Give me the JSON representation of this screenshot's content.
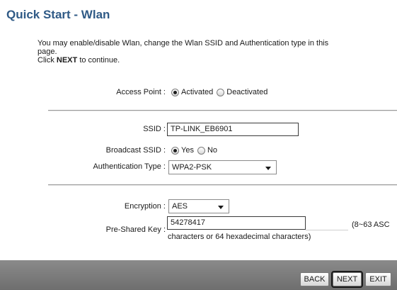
{
  "page": {
    "title": "Quick Start - Wlan",
    "intro_line1": "You may enable/disable Wlan, change the Wlan SSID and Authentication type in this",
    "intro_line2": "page.",
    "intro_click": "Click",
    "intro_next": "NEXT",
    "intro_continue": "to continue."
  },
  "access_point": {
    "label": "Access Point :",
    "options": [
      "Activated",
      "Deactivated"
    ],
    "selected": "Activated"
  },
  "ssid": {
    "label": "SSID :",
    "value": "TP-LINK_EB6901"
  },
  "broadcast_ssid": {
    "label": "Broadcast SSID :",
    "options": [
      "Yes",
      "No"
    ],
    "selected": "Yes"
  },
  "authentication": {
    "label": "Authentication Type :",
    "value": "WPA2-PSK"
  },
  "encryption": {
    "label": "Encryption :",
    "value": "AES"
  },
  "psk": {
    "label": "Pre-Shared Key :",
    "value": "54278417",
    "hint_a": "(8~63 ASC",
    "hint_b": "characters or 64 hexadecimal characters)"
  },
  "buttons": {
    "back": "BACK",
    "next": "NEXT",
    "exit": "EXIT"
  }
}
